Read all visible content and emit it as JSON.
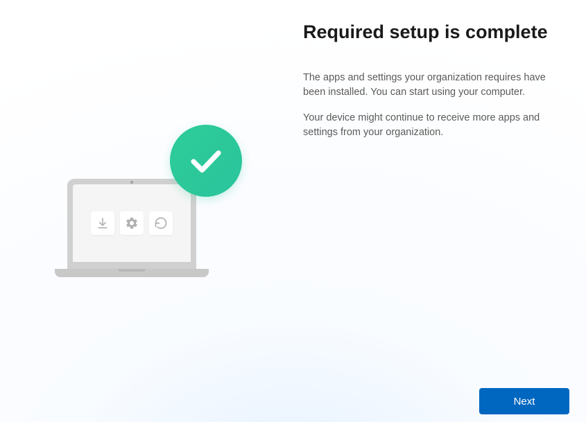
{
  "heading": "Required setup is complete",
  "paragraph1": "The apps and settings your organization requires have been installed. You can start using your computer.",
  "paragraph2": "Your device might continue to receive more apps and settings from your organization.",
  "buttons": {
    "next_label": "Next"
  },
  "illustration": {
    "tiles": [
      "download",
      "settings",
      "refresh"
    ],
    "badge": "checkmark"
  }
}
